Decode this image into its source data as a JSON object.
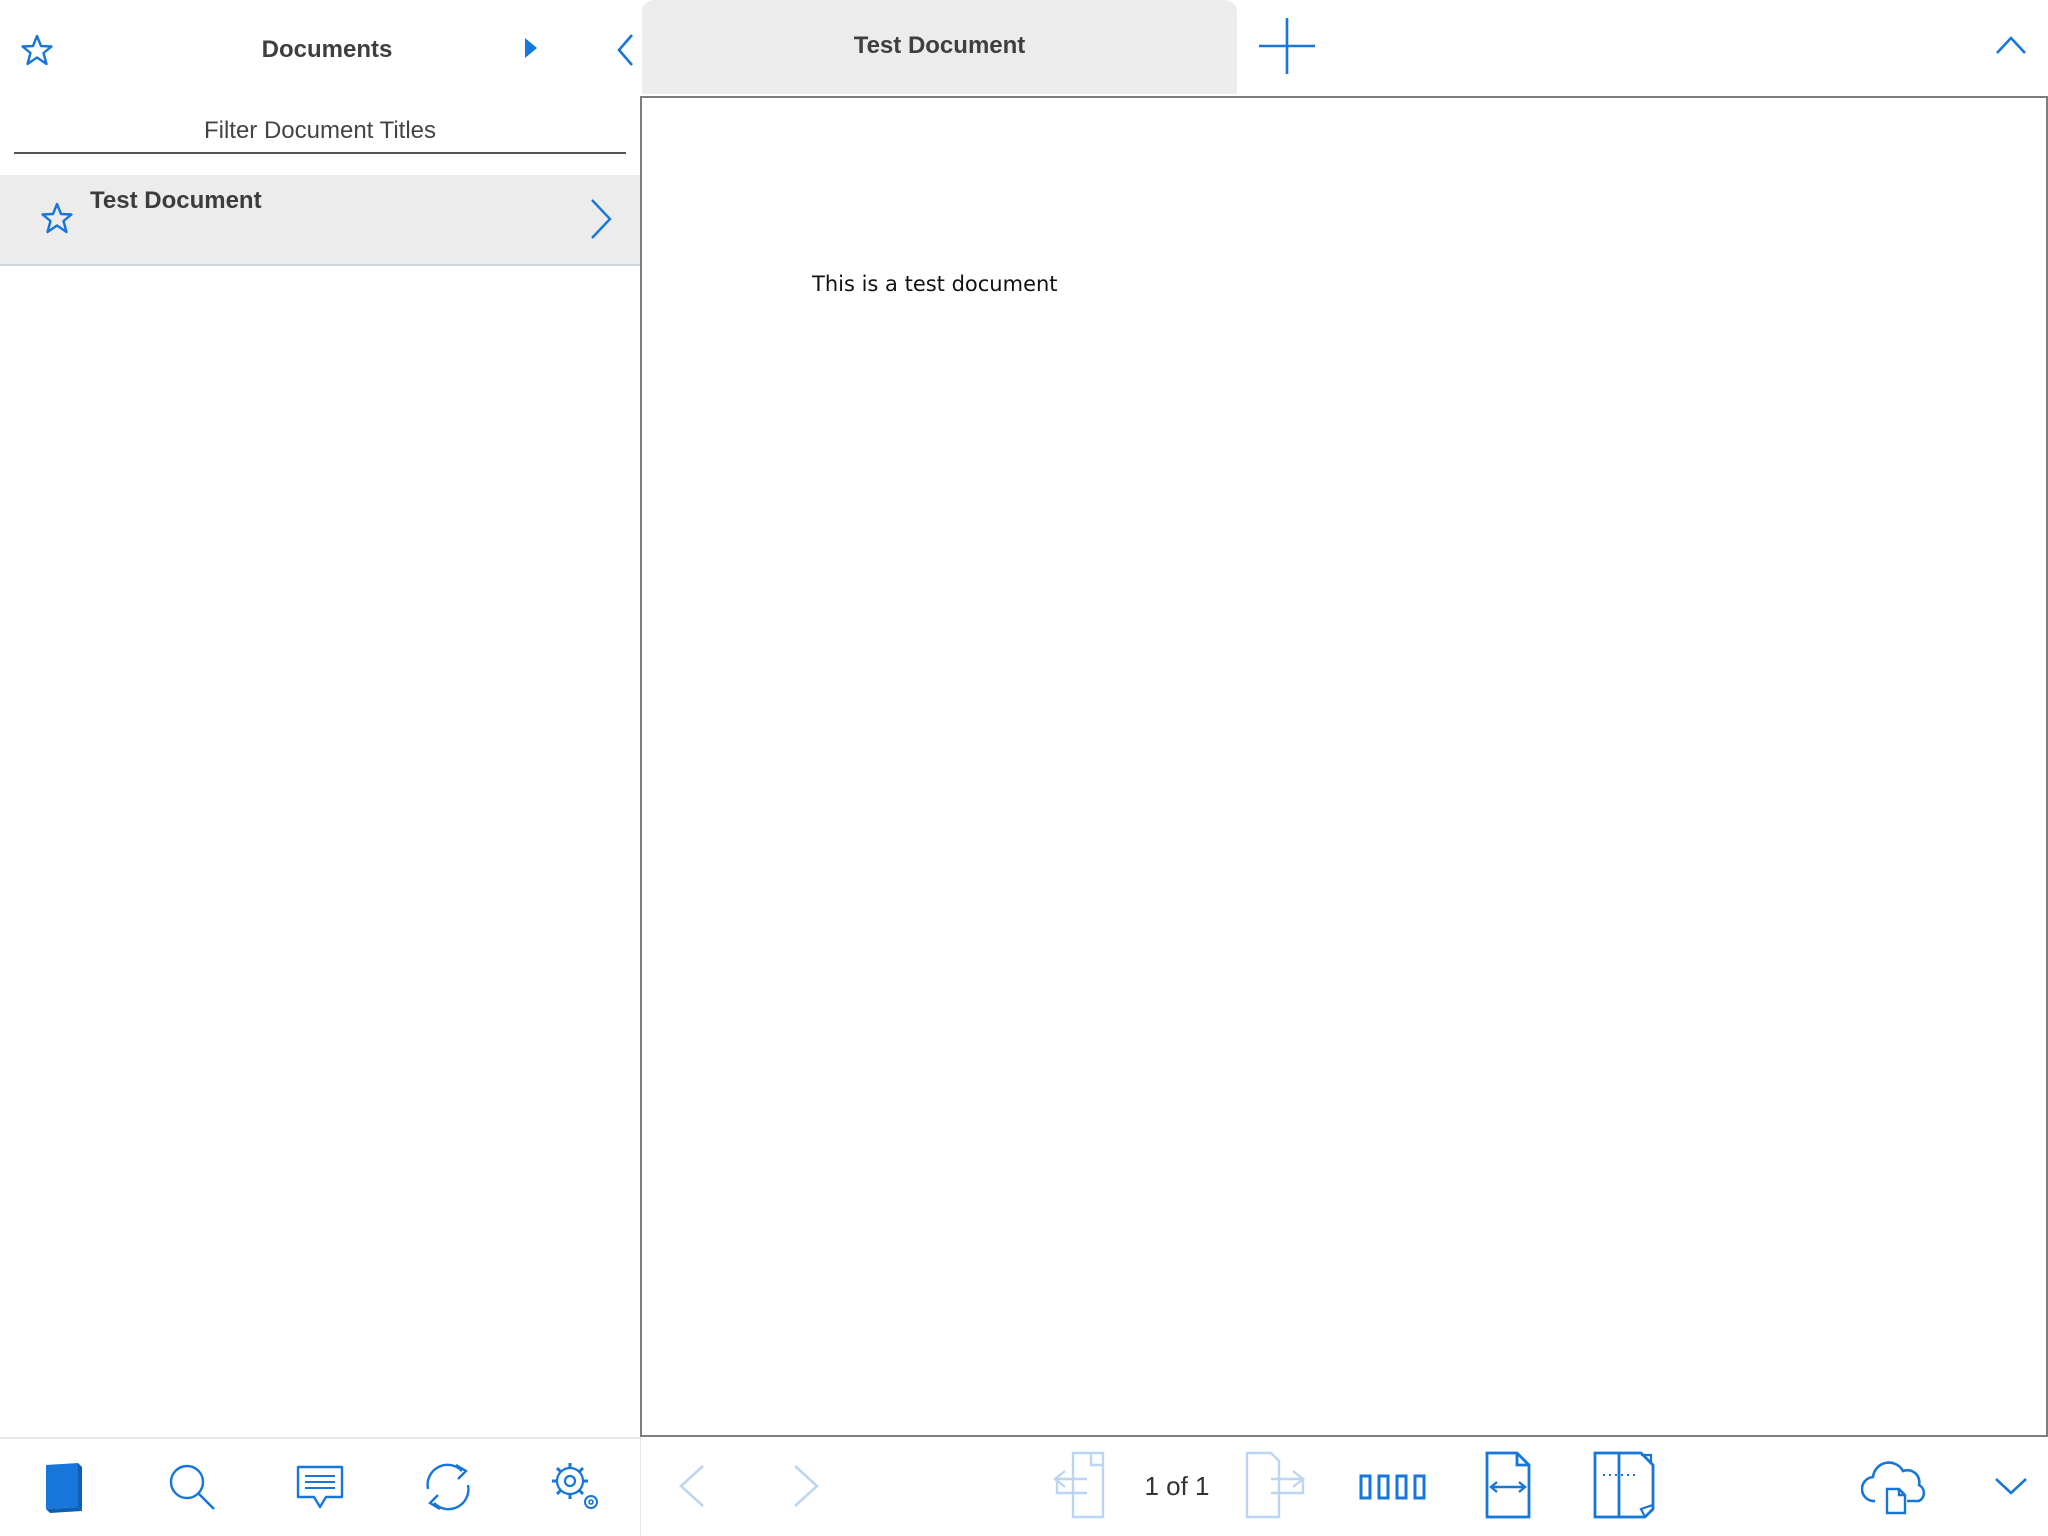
{
  "sidebar": {
    "title": "Documents",
    "filter": {
      "placeholder": "Filter Document Titles",
      "value": ""
    },
    "documents": [
      {
        "title": "Test Document",
        "favorite": false
      }
    ],
    "toolbar": {
      "items": [
        "book-icon",
        "search-icon",
        "comments-icon",
        "sync-icon",
        "settings-icon"
      ]
    }
  },
  "tabs": [
    {
      "label": "Test Document",
      "active": true
    }
  ],
  "viewer": {
    "content_text": "This is a test document",
    "page_counter": "1 of 1"
  },
  "colors": {
    "accent": "#1676d9",
    "accent_disabled": "#bcd6f2",
    "tab_background": "#ececec",
    "text": "#3c3c3c"
  }
}
